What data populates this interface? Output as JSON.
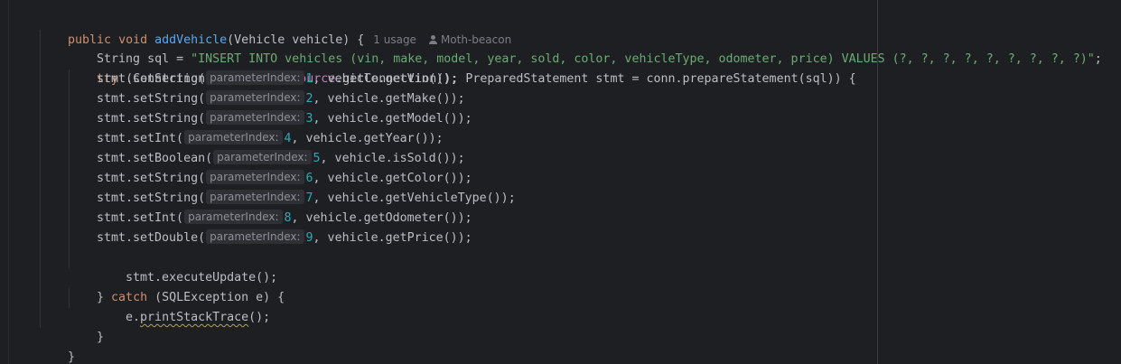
{
  "method": {
    "modifiers": "public void",
    "name": "addVehicle",
    "params": "(Vehicle vehicle) {",
    "usages": "1 usage",
    "author_icon": "person-icon",
    "author": "Moth-beacon"
  },
  "sql_line": {
    "decl": "String sql = ",
    "value": "\"INSERT INTO vehicles (vin, make, model, year, sold, color, vehicleType, odometer, price) VALUES (?, ?, ?, ?, ?, ?, ?, ?, ?)\"",
    "end": ";"
  },
  "try_line": {
    "kw": "try",
    "open": " (Connection conn = ",
    "field": "dataSource",
    "rest": ".getConnection(); PreparedStatement stmt = conn.prepareStatement(sql)) {"
  },
  "setters": [
    {
      "call": "stmt.setString(",
      "hint": "parameterIndex:",
      "index": "1",
      "arg": ", vehicle.getVin());"
    },
    {
      "call": "stmt.setString(",
      "hint": "parameterIndex:",
      "index": "2",
      "arg": ", vehicle.getMake());"
    },
    {
      "call": "stmt.setString(",
      "hint": "parameterIndex:",
      "index": "3",
      "arg": ", vehicle.getModel());"
    },
    {
      "call": "stmt.setInt(",
      "hint": "parameterIndex:",
      "index": "4",
      "arg": ", vehicle.getYear());"
    },
    {
      "call": "stmt.setBoolean(",
      "hint": "parameterIndex:",
      "index": "5",
      "arg": ", vehicle.isSold());"
    },
    {
      "call": "stmt.setString(",
      "hint": "parameterIndex:",
      "index": "6",
      "arg": ", vehicle.getColor());"
    },
    {
      "call": "stmt.setString(",
      "hint": "parameterIndex:",
      "index": "7",
      "arg": ", vehicle.getVehicleType());"
    },
    {
      "call": "stmt.setInt(",
      "hint": "parameterIndex:",
      "index": "8",
      "arg": ", vehicle.getOdometer());"
    },
    {
      "call": "stmt.setDouble(",
      "hint": "parameterIndex:",
      "index": "9",
      "arg": ", vehicle.getPrice());"
    }
  ],
  "execute_line": "stmt.executeUpdate();",
  "catch_line": {
    "close": "} ",
    "kw": "catch",
    "rest": " (SQLException e) {"
  },
  "print_line": {
    "prefix": "e.",
    "method": "printStackTrace",
    "suffix": "();"
  },
  "close_inner": "}",
  "close_method": "}"
}
